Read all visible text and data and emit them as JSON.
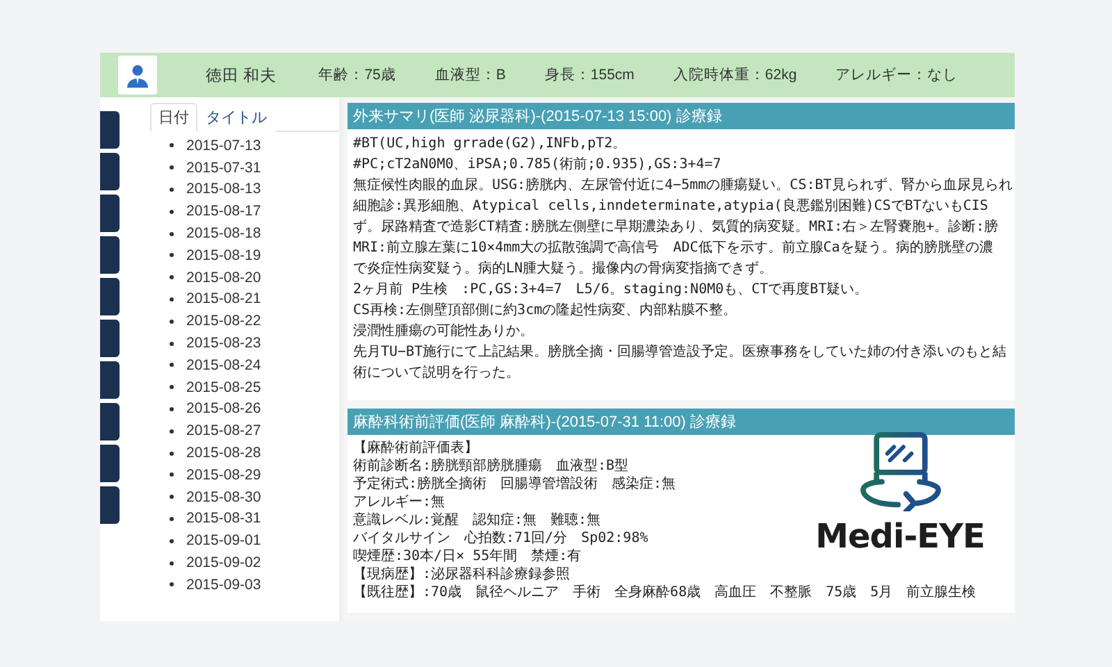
{
  "patient": {
    "name": "徳田 和夫",
    "fields": [
      "年齢：75歳",
      "血液型：B",
      "身長：155cm",
      "入院時体重：62kg",
      "アレルギー：なし"
    ]
  },
  "list_tabs": [
    {
      "label": "日付",
      "selected": true
    },
    {
      "label": "タイトル",
      "selected": false
    }
  ],
  "dates": [
    "2015-07-13",
    "2015-07-31",
    "2015-08-13",
    "2015-08-17",
    "2015-08-18",
    "2015-08-19",
    "2015-08-20",
    "2015-08-21",
    "2015-08-22",
    "2015-08-23",
    "2015-08-24",
    "2015-08-25",
    "2015-08-26",
    "2015-08-27",
    "2015-08-28",
    "2015-08-29",
    "2015-08-30",
    "2015-08-31",
    "2015-09-01",
    "2015-09-02",
    "2015-09-03"
  ],
  "records": [
    {
      "title": "外来サマリ(医師 泌尿器科)-(2015-07-13 15:00) 診療録",
      "lines": [
        "#BT(UC,high grrade(G2),INFb,pT2。",
        "#PC;cT2aN0M0、iPSA;0.785(術前;0.935),GS:3+4=7",
        "無症候性肉眼的血尿。USG:膀胱内、左尿管付近に4−5mmの腫瘍疑い。CS:BT見られず、腎から血尿見られ",
        "細胞診:異形細胞、Atypical cells,inndeterminate,atypia(良悪鑑別困難)CSでBTないもCIS",
        "ず。尿路精査で造影CT精査:膀胱左側壁に早期濃染あり、気質的病変疑。MRI:右＞左腎嚢胞+。診断:膀",
        "MRI:前立腺左葉に10×4mm大の拡散強調で高信号　ADC低下を示す。前立腺Caを疑う。病的膀胱壁の濃",
        "で炎症性病変疑う。病的LN腫大疑う。撮像内の骨病変指摘できず。",
        "2ヶ月前 P生検　:PC,GS:3+4=7　L5/6。staging:N0M0も、CTで再度BT疑い。",
        "CS再検:左側壁頂部側に約3cmの隆起性病変、内部粘膜不整。",
        "浸潤性腫瘍の可能性ありか。",
        "先月TU−BT施行にて上記結果。膀胱全摘・回腸導管造設予定。医療事務をしていた姉の付き添いのもと結",
        "術について説明を行った。"
      ]
    },
    {
      "title": "麻酔科術前評価(医師 麻酔科)-(2015-07-31 11:00) 診療録",
      "lines": [
        "【麻酔術前評価表】",
        "術前診断名:膀胱頸部膀胱腫瘍　血液型:B型",
        "予定術式:膀胱全摘術　回腸導管増設術　感染症:無",
        "アレルギー:無",
        "意識レベル:覚醒　認知症:無　難聴:無",
        "バイタルサイン　心拍数:71回/分　Sp02:98%",
        "喫煙歴:30本/日× 55年間　禁煙:有",
        "【現病歴】:泌尿器科科診療録参照",
        "【既往歴】:70歳　鼠径ヘルニア　手術　全身麻酔68歳　高血圧　不整脈　75歳　5月　前立腺生検"
      ]
    }
  ],
  "logo": {
    "text": "Medi-EYE"
  }
}
